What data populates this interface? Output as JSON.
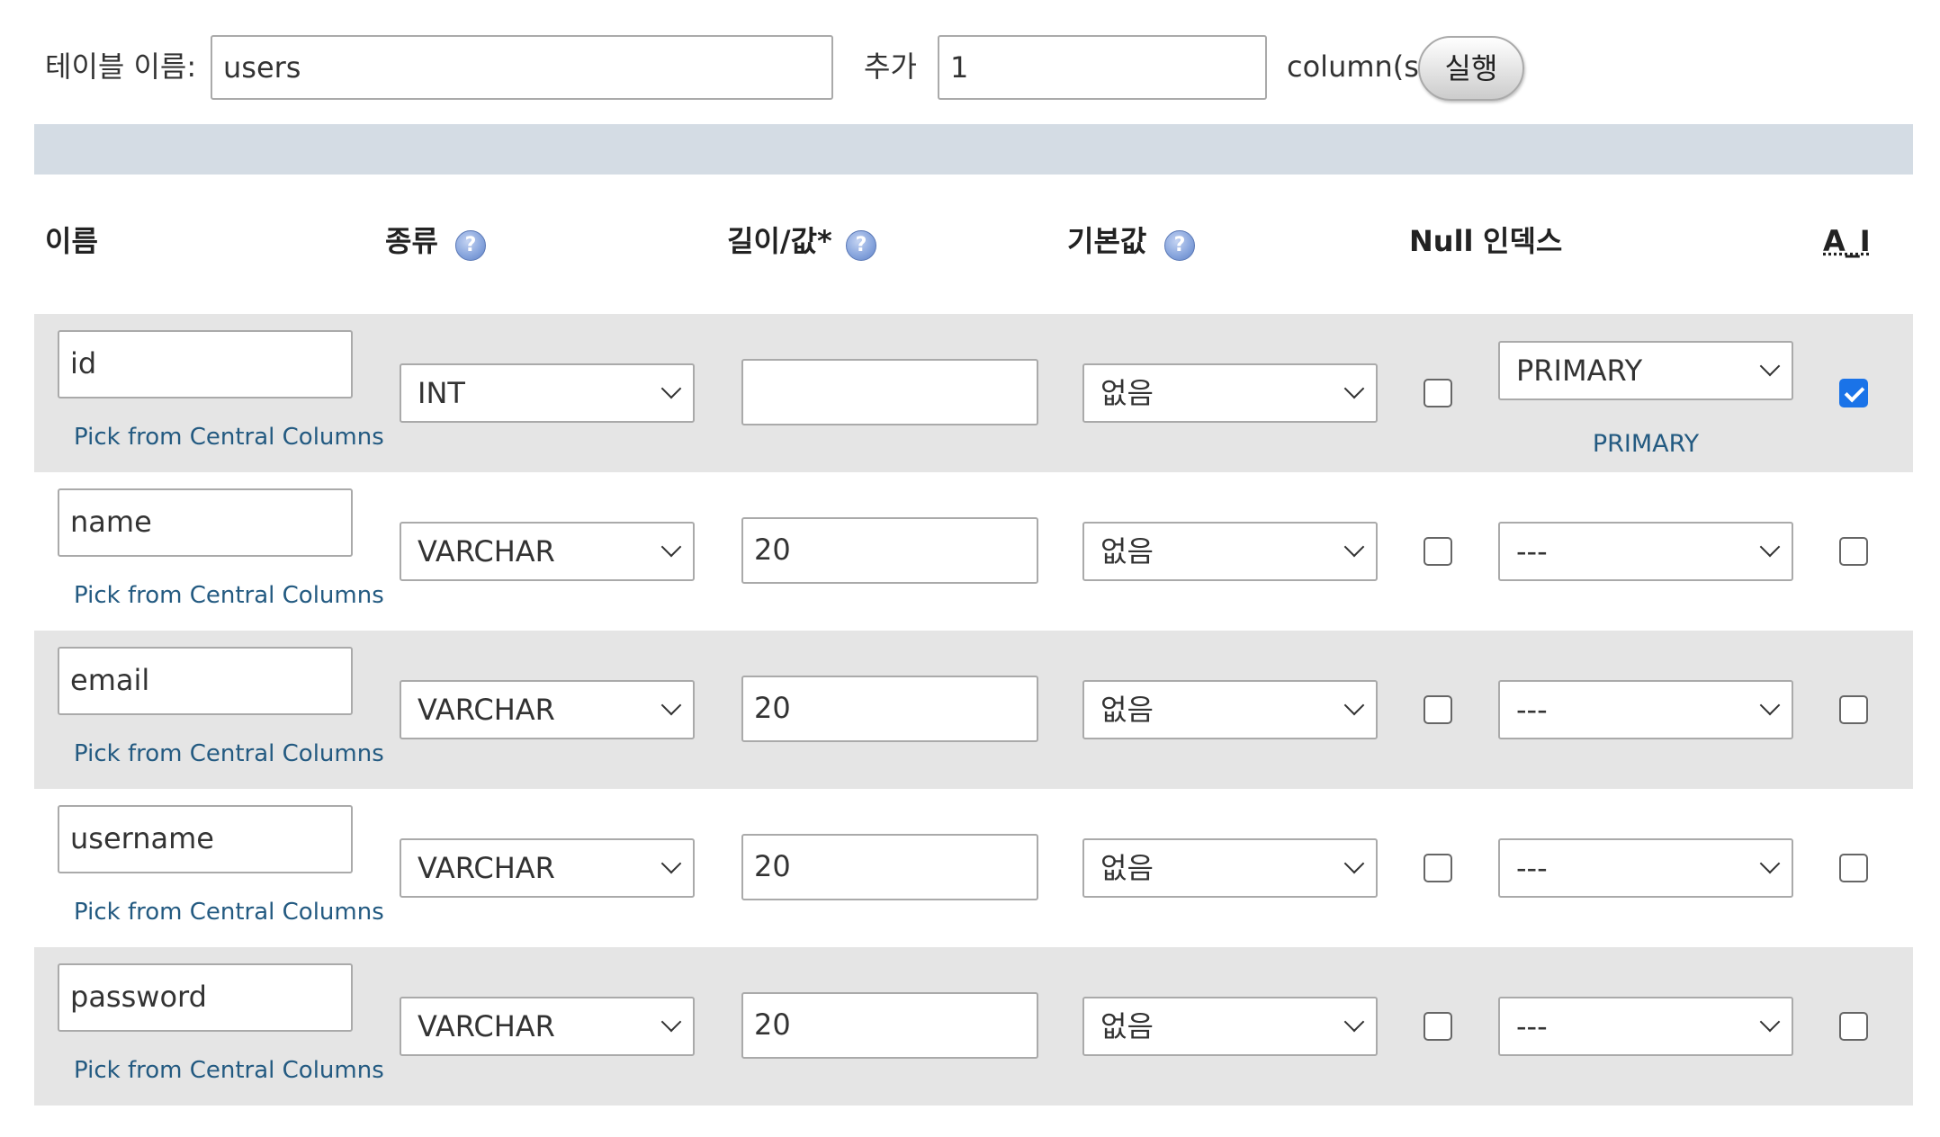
{
  "toolbar": {
    "table_name_label": "테이블 이름:",
    "table_name_value": "users",
    "add_label": "추가",
    "add_count_value": "1",
    "columns_suffix": "column(s)",
    "go_button": "실행"
  },
  "header": {
    "name": "이름",
    "type": "종류",
    "length": "길이/값*",
    "default": "기본값",
    "null": "Null",
    "index": "인덱스",
    "ai": "A_I",
    "help_icon": "?"
  },
  "rows": [
    {
      "name": "id",
      "pick_link": "Pick from Central Columns",
      "type": "INT",
      "length": "",
      "default": "없음",
      "null_checked": false,
      "index": "PRIMARY",
      "index_note": "PRIMARY",
      "ai_checked": true
    },
    {
      "name": "name",
      "pick_link": "Pick from Central Columns",
      "type": "VARCHAR",
      "length": "20",
      "default": "없음",
      "null_checked": false,
      "index": "---",
      "ai_checked": false
    },
    {
      "name": "email",
      "pick_link": "Pick from Central Columns",
      "type": "VARCHAR",
      "length": "20",
      "default": "없음",
      "null_checked": false,
      "index": "---",
      "ai_checked": false
    },
    {
      "name": "username",
      "pick_link": "Pick from Central Columns",
      "type": "VARCHAR",
      "length": "20",
      "default": "없음",
      "null_checked": false,
      "index": "---",
      "ai_checked": false
    },
    {
      "name": "password",
      "pick_link": "Pick from Central Columns",
      "type": "VARCHAR",
      "length": "20",
      "default": "없음",
      "null_checked": false,
      "index": "---",
      "ai_checked": false
    }
  ],
  "colors": {
    "band": "#d4dce4",
    "row_alt": "#e5e5e5",
    "link": "#235a81",
    "checkbox_checked": "#1a73e8"
  }
}
